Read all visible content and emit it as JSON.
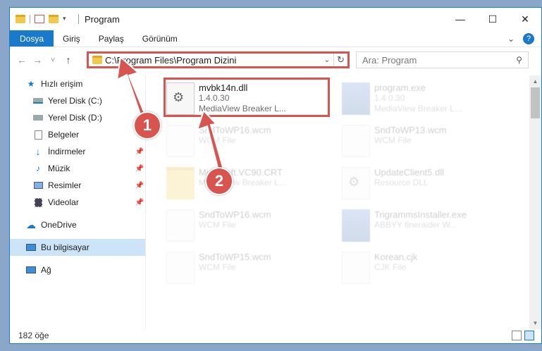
{
  "window": {
    "title": "Program",
    "controls": {
      "minimize": "—",
      "maximize": "☐",
      "close": "✕"
    }
  },
  "ribbon": {
    "tabs": [
      "Dosya",
      "Giriş",
      "Paylaş",
      "Görünüm"
    ],
    "active_tab": "Dosya"
  },
  "navigation": {
    "back": "←",
    "forward": "→",
    "recent": "˅",
    "up": "↑",
    "address_path": "C:\\Program Files\\Program Dizini",
    "search_placeholder": "Ara: Program"
  },
  "sidebar": {
    "items": [
      {
        "label": "Hızlı erişim",
        "icon": "star-icon"
      },
      {
        "label": "Yerel Disk (C:)",
        "icon": "drive-icon"
      },
      {
        "label": "Yerel Disk (D:)",
        "icon": "drive-icon"
      },
      {
        "label": "Belgeler",
        "icon": "documents-icon"
      },
      {
        "label": "İndirmeler",
        "icon": "download-icon"
      },
      {
        "label": "Müzik",
        "icon": "music-icon"
      },
      {
        "label": "Resimler",
        "icon": "pictures-icon"
      },
      {
        "label": "Videolar",
        "icon": "videos-icon"
      },
      {
        "label": "OneDrive",
        "icon": "cloud-icon"
      },
      {
        "label": "Bu bilgisayar",
        "icon": "computer-icon"
      },
      {
        "label": "Ağ",
        "icon": "network-icon"
      }
    ]
  },
  "files": [
    {
      "name": "mvbk14n.dll",
      "sub1": "1.4.0.30",
      "sub2": "MediaView Breaker L..."
    },
    {
      "name": "program.exe",
      "sub1": "1.4.0.30",
      "sub2": "MediaView Breaker L..."
    },
    {
      "name": "SndToWP16.wcm",
      "sub1": "WCM File",
      "sub2": ""
    },
    {
      "name": "SndToWP13.wcm",
      "sub1": "WCM File",
      "sub2": ""
    },
    {
      "name": "Microsoft.VC90.CRT",
      "sub1": "",
      "sub2": "MediaView Breaker L..."
    },
    {
      "name": "UpdateClient5.dll",
      "sub1": "Resource DLL",
      "sub2": ""
    },
    {
      "name": "SndToWP16.wcm",
      "sub1": "WCM File",
      "sub2": ""
    },
    {
      "name": "TrigrammsInstaller.exe",
      "sub1": "ABBYY fineraider W...",
      "sub2": ""
    },
    {
      "name": "SndToWP15.wcm",
      "sub1": "WCM File",
      "sub2": ""
    },
    {
      "name": "Korean.cjk",
      "sub1": "CJK File",
      "sub2": ""
    }
  ],
  "status": {
    "count": "182 öğe"
  },
  "annotations": {
    "step1": "1",
    "step2": "2"
  },
  "colors": {
    "accent": "#1979ca",
    "highlight": "#d9534f"
  }
}
